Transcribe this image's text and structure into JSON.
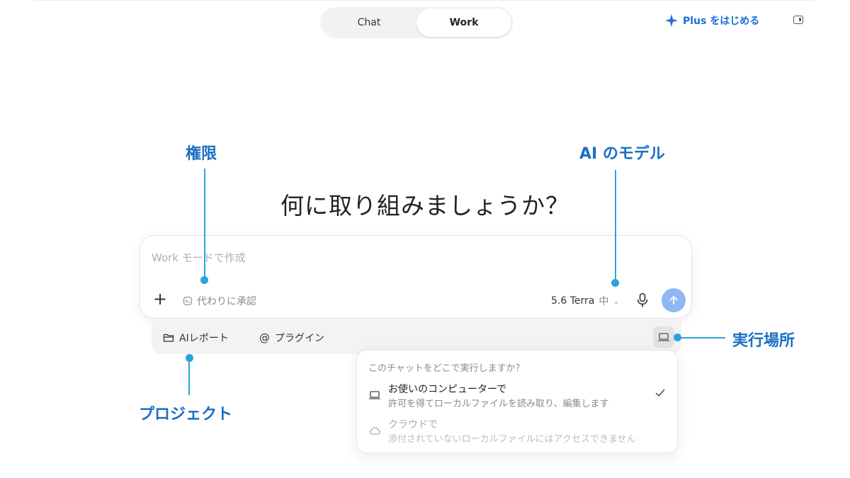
{
  "mode_toggle": {
    "tabs": [
      {
        "label": "Chat",
        "active": false
      },
      {
        "label": "Work",
        "active": true
      }
    ]
  },
  "plus": {
    "label": "Plus をはじめる",
    "icon": "sparkle-icon",
    "color": "#1f6fd6"
  },
  "headline": "何に取り組みましょうか？",
  "composer": {
    "placeholder": "Work モードで作成",
    "approve_label": "代わりに承認",
    "model_label": "5.6 Terra",
    "effort_label": "中",
    "send_color": "#8fb7f4"
  },
  "tray": {
    "project_label": "AIレポート",
    "plugin_label": "プラグイン"
  },
  "location_menu": {
    "header": "このチャットをどこで実行しますか？",
    "options": [
      {
        "title": "お使いのコンピューターで",
        "description": "許可を得てローカルファイルを読み取り、編集します",
        "icon": "laptop-icon",
        "selected": true
      },
      {
        "title": "クラウドで",
        "description": "添付されていないローカルファイルにはアクセスできません",
        "icon": "cloud-icon",
        "selected": false,
        "disabled": true
      }
    ]
  },
  "annotations": {
    "permissions": "権限",
    "model": "AI のモデル",
    "run_location": "実行場所",
    "project": "プロジェクト",
    "color": "#1a6fc2",
    "line_color": "#2aa3e0"
  }
}
